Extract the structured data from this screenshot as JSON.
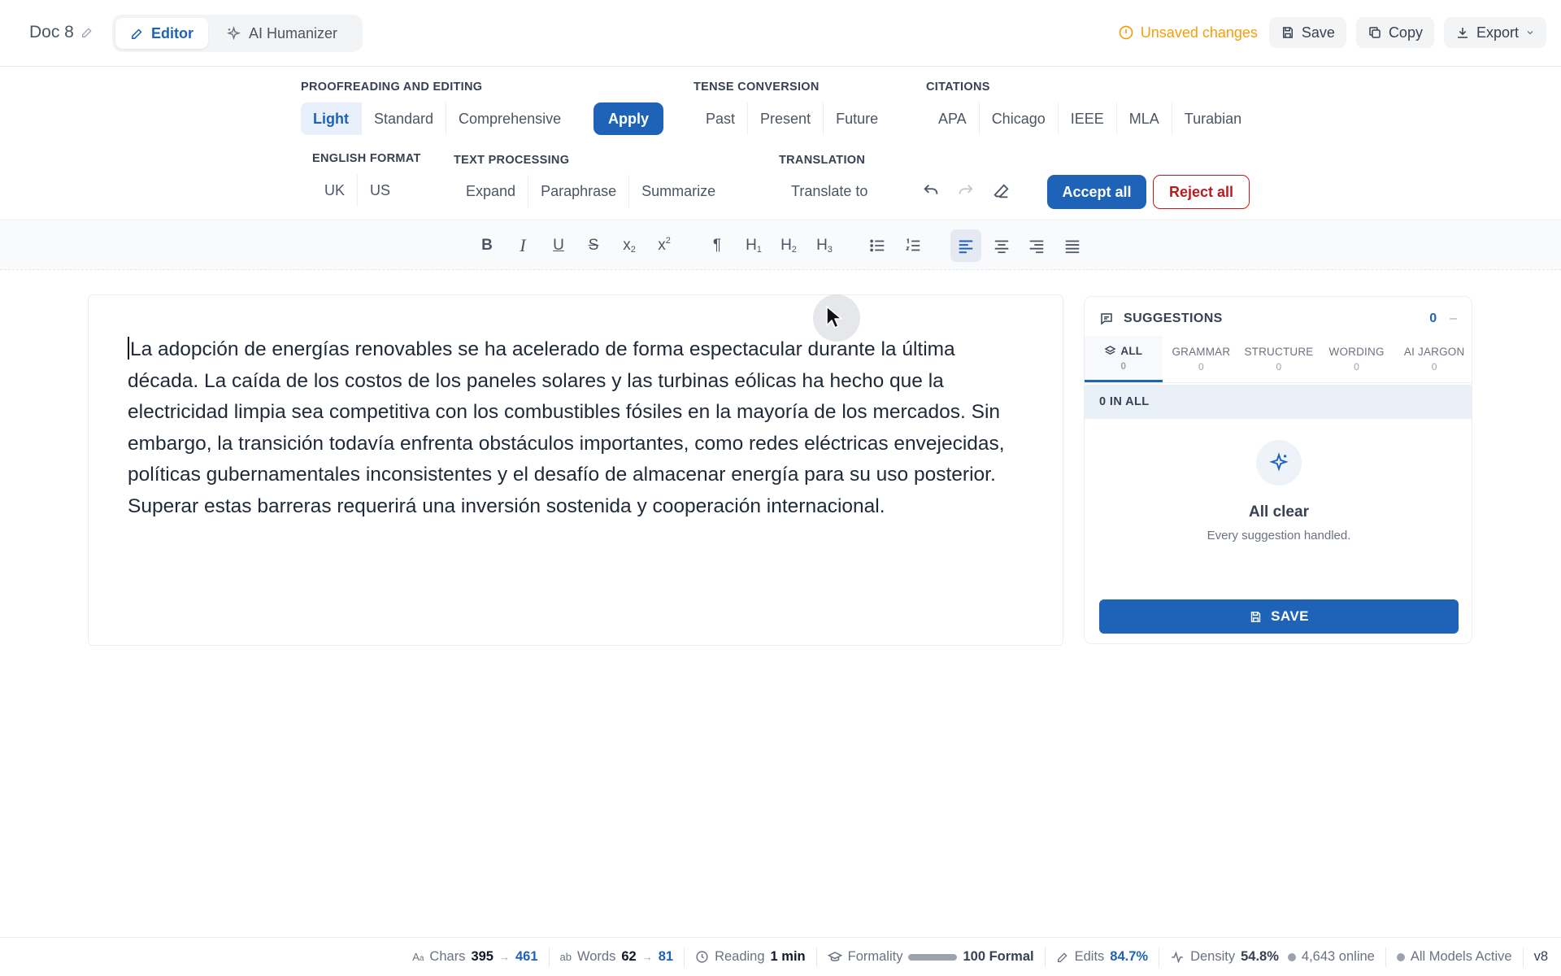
{
  "header": {
    "doc_title": "Doc 8",
    "tabs": [
      {
        "label": "Editor",
        "icon": "pencil-icon",
        "active": true
      },
      {
        "label": "AI Humanizer",
        "icon": "sparkle-icon",
        "active": false
      }
    ],
    "unsaved_text": "Unsaved changes",
    "save_label": "Save",
    "copy_label": "Copy",
    "export_label": "Export"
  },
  "tools": {
    "proofreading": {
      "label": "PROOFREADING AND EDITING",
      "options": [
        "Light",
        "Standard",
        "Comprehensive"
      ],
      "selected": "Light",
      "apply_label": "Apply"
    },
    "tense": {
      "label": "TENSE CONVERSION",
      "options": [
        "Past",
        "Present",
        "Future"
      ]
    },
    "citations": {
      "label": "CITATIONS",
      "options": [
        "APA",
        "Chicago",
        "IEEE",
        "MLA",
        "Turabian"
      ]
    },
    "english_format": {
      "label": "ENGLISH FORMAT",
      "options": [
        "UK",
        "US"
      ]
    },
    "text_processing": {
      "label": "TEXT PROCESSING",
      "options": [
        "Expand",
        "Paraphrase",
        "Summarize"
      ]
    },
    "translation": {
      "label": "TRANSLATION",
      "option": "Translate to"
    },
    "accept_all_label": "Accept all",
    "reject_all_label": "Reject all"
  },
  "format_toolbar": {
    "items": [
      "bold",
      "italic",
      "underline",
      "strikethrough",
      "subscript",
      "superscript",
      "paragraph",
      "heading-1",
      "heading-2",
      "heading-3",
      "bullet-list",
      "numbered-list",
      "align-left",
      "align-center",
      "align-right",
      "align-justify"
    ],
    "active_alignment": "align-left"
  },
  "editor": {
    "text": "La adopción de energías renovables se ha acelerado de forma espectacular durante la última década. La caída de los costos de los paneles solares y las turbinas eólicas ha hecho que la electricidad limpia sea competitiva con los combustibles fósiles en la mayoría de los mercados. Sin embargo, la transición todavía enfrenta obstáculos importantes, como redes eléctricas envejecidas, políticas gubernamentales inconsistentes y el desafío de almacenar energía para su uso posterior. Superar estas barreras requerirá una inversión sostenida y cooperación internacional."
  },
  "suggestions": {
    "title": "SUGGESTIONS",
    "count": "0",
    "minimize": "–",
    "categories": [
      {
        "label": "ALL",
        "count": "0",
        "active": true
      },
      {
        "label": "GRAMMAR",
        "count": "0"
      },
      {
        "label": "STRUCTURE",
        "count": "0"
      },
      {
        "label": "WORDING",
        "count": "0"
      },
      {
        "label": "AI JARGON",
        "count": "0"
      }
    ],
    "in_all": "0 IN ALL",
    "empty_title": "All clear",
    "empty_sub": "Every suggestion handled.",
    "save_label": "SAVE"
  },
  "status_bar": {
    "chars_label": "Chars",
    "chars_from": "395",
    "chars_to": "461",
    "arrow": "→",
    "words_label": "Words",
    "words_from": "62",
    "words_to": "81",
    "reading_label": "Reading",
    "reading_value": "1 min",
    "formality_label": "Formality",
    "formality_value": "100 Formal",
    "formality_level": 1.0,
    "edits_label": "Edits",
    "edits_value": "84.7%",
    "density_label": "Density",
    "density_value": "54.8%",
    "online_text": "4,643 online",
    "models_text": "All Models Active",
    "version": "v8"
  },
  "colors": {
    "accent": "#1e63b8",
    "warning": "#f59e0b",
    "danger": "#b91c1c"
  }
}
